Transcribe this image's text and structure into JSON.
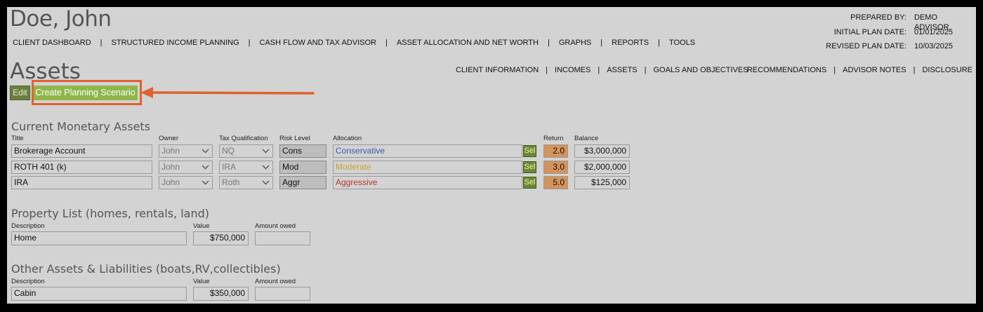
{
  "client": {
    "name": "Doe, John"
  },
  "plan_info": [
    {
      "label": "PREPARED BY:",
      "value": "DEMO ADVISOR"
    },
    {
      "label": "INITIAL PLAN DATE:",
      "value": "01/01/2025"
    },
    {
      "label": "REVISED PLAN DATE:",
      "value": "10/03/2025"
    }
  ],
  "main_nav": [
    "CLIENT DASHBOARD",
    "STRUCTURED INCOME PLANNING",
    "CASH FLOW AND TAX ADVISOR",
    "ASSET ALLOCATION AND NET WORTH",
    "GRAPHS",
    "REPORTS",
    "TOOLS"
  ],
  "page": {
    "title": "Assets"
  },
  "sub_nav_left": [
    "CLIENT INFORMATION",
    "INCOMES",
    "ASSETS",
    "GOALS AND OBJECTIVES"
  ],
  "sub_nav_right": [
    "RECOMMENDATIONS",
    "ADVISOR NOTES",
    "DISCLOSURE"
  ],
  "buttons": {
    "edit": "Edit",
    "create": "Create Planning Scenario",
    "sel": "Sel"
  },
  "monetary": {
    "title": "Current Monetary Assets",
    "headers": {
      "title": "Title",
      "owner": "Owner",
      "tax": "Tax Qualification",
      "risk": "Risk Level",
      "allocation": "Allocation",
      "return": "Return",
      "balance": "Balance"
    },
    "rows": [
      {
        "title": "Brokerage Account",
        "owner": "John",
        "tax": "NQ",
        "risk": "Cons",
        "allocation": "Conservative",
        "allocation_color": "#3a5aa8",
        "return": "2.0",
        "balance": "$3,000,000"
      },
      {
        "title": "ROTH 401 (k)",
        "owner": "John",
        "tax": "IRA",
        "risk": "Mod",
        "allocation": "Moderate",
        "allocation_color": "#c9a227",
        "return": "3.0",
        "balance": "$2,000,000"
      },
      {
        "title": "IRA",
        "owner": "John",
        "tax": "Roth",
        "risk": "Aggr",
        "allocation": "Aggressive",
        "allocation_color": "#b23a2a",
        "return": "5.0",
        "balance": "$125,000"
      }
    ]
  },
  "property": {
    "title": "Property List (homes, rentals, land)",
    "headers": {
      "description": "Description",
      "value": "Value",
      "owed": "Amount owed"
    },
    "rows": [
      {
        "description": "Home",
        "value": "$750,000",
        "owed": ""
      }
    ]
  },
  "other": {
    "title": "Other Assets & Liabilities (boats,RV,collectibles)",
    "headers": {
      "description": "Description",
      "value": "Value",
      "owed": "Amount owed"
    },
    "rows": [
      {
        "description": "Cabin",
        "value": "$350,000",
        "owed": ""
      }
    ]
  },
  "colors": {
    "edit_button": "#6b7f3e",
    "create_button": "#8fb64a",
    "annotation": "#e06030",
    "return_cell": "#d4935a"
  }
}
